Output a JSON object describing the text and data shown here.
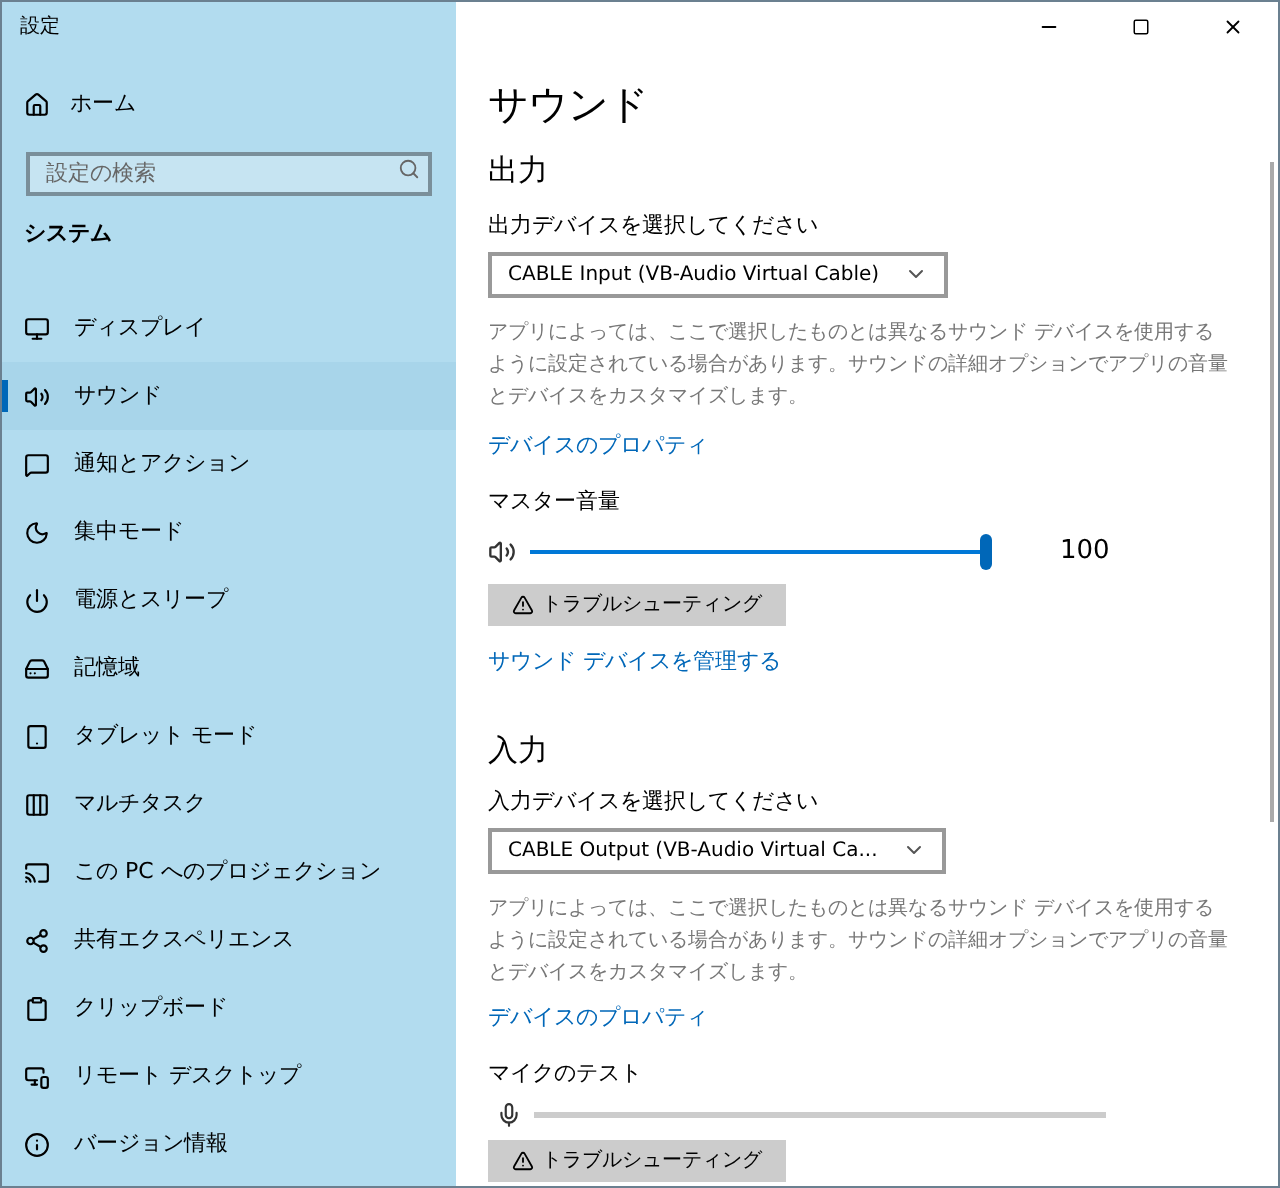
{
  "window": {
    "title": "設定"
  },
  "sidebar": {
    "home": "ホーム",
    "search": {
      "placeholder": "設定の検索"
    },
    "section": "システム",
    "items": [
      {
        "label": "ディスプレイ",
        "selected": false
      },
      {
        "label": "サウンド",
        "selected": true
      },
      {
        "label": "通知とアクション",
        "selected": false
      },
      {
        "label": "集中モード",
        "selected": false
      },
      {
        "label": "電源とスリープ",
        "selected": false
      },
      {
        "label": "記憶域",
        "selected": false
      },
      {
        "label": "タブレット モード",
        "selected": false
      },
      {
        "label": "マルチタスク",
        "selected": false
      },
      {
        "label": "この PC へのプロジェクション",
        "selected": false
      },
      {
        "label": "共有エクスペリエンス",
        "selected": false
      },
      {
        "label": "クリップボード",
        "selected": false
      },
      {
        "label": "リモート デスクトップ",
        "selected": false
      },
      {
        "label": "バージョン情報",
        "selected": false
      }
    ]
  },
  "page": {
    "title": "サウンド",
    "output": {
      "heading": "出力",
      "select_label": "出力デバイスを選択してください",
      "device": "CABLE Input (VB-Audio Virtual Cable)",
      "description": "アプリによっては、ここで選択したものとは異なるサウンド デバイスを使用するように設定されている場合があります。サウンドの詳細オプションでアプリの音量とデバイスをカスタマイズします。",
      "properties_link": "デバイスのプロパティ",
      "volume_label": "マスター音量",
      "volume": {
        "level": 1.0,
        "reading": "100"
      },
      "troubleshoot": "トラブルシューティング",
      "manage_link": "サウンド デバイスを管理する"
    },
    "input": {
      "heading": "入力",
      "select_label": "入力デバイスを選択してください",
      "device": "CABLE Output (VB-Audio Virtual Ca...",
      "description": "アプリによっては、ここで選択したものとは異なるサウンド デバイスを使用するように設定されている場合があります。サウンドの詳細オプションでアプリの音量とデバイスをカスタマイズします。",
      "properties_link": "デバイスのプロパティ",
      "mic_test_label": "マイクのテスト",
      "troubleshoot": "トラブルシューティング"
    }
  }
}
